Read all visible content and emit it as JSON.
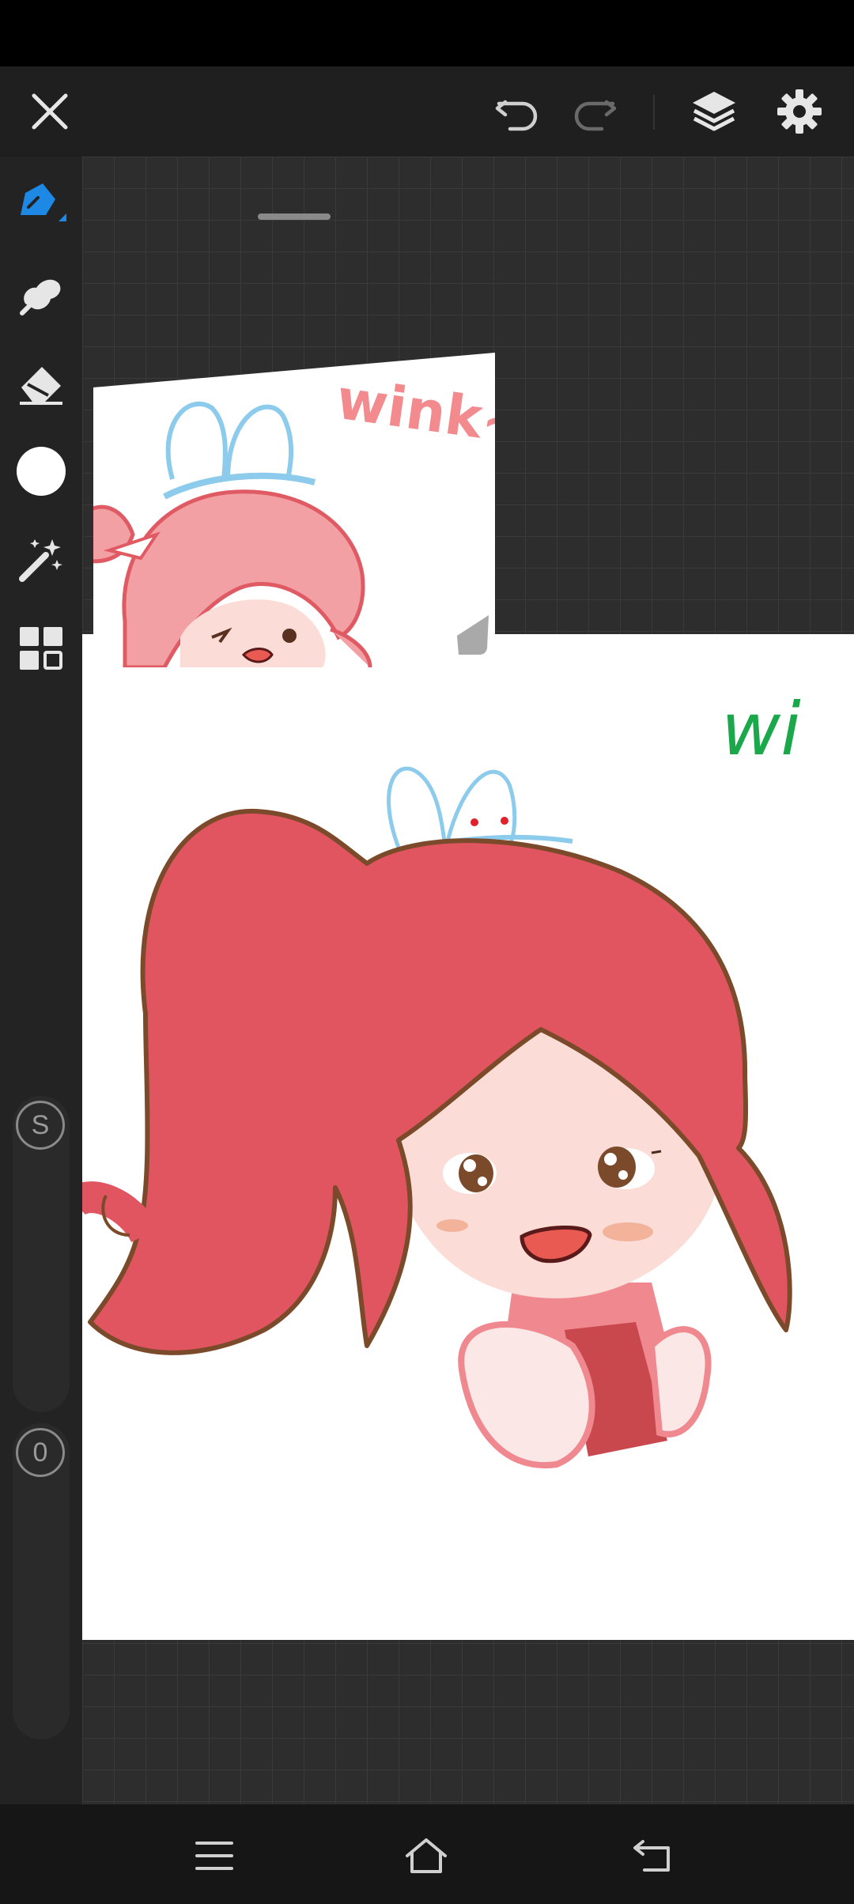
{
  "toolbar": {
    "close": "close-icon",
    "undo": "undo-icon",
    "redo": "redo-icon",
    "layers": "layers-icon",
    "settings": "gear-icon"
  },
  "tools": [
    {
      "name": "pen",
      "icon": "pen-icon",
      "active": true
    },
    {
      "name": "smudge",
      "icon": "smudge-icon"
    },
    {
      "name": "eraser",
      "icon": "eraser-icon"
    },
    {
      "name": "color",
      "icon": "color-circle",
      "color": "#ffffff"
    },
    {
      "name": "magic",
      "icon": "magic-wand-icon"
    },
    {
      "name": "more",
      "icon": "grid-icon"
    }
  ],
  "sliders": {
    "size_label": "S",
    "opacity_label": "0"
  },
  "reference": {
    "text": "wink~"
  },
  "canvas": {
    "text_fragment": "wi"
  },
  "colors": {
    "accent": "#1e88e5",
    "hair": "#e05a64",
    "hair_outline": "#7a4a2a",
    "green_text": "#1aa84a"
  }
}
